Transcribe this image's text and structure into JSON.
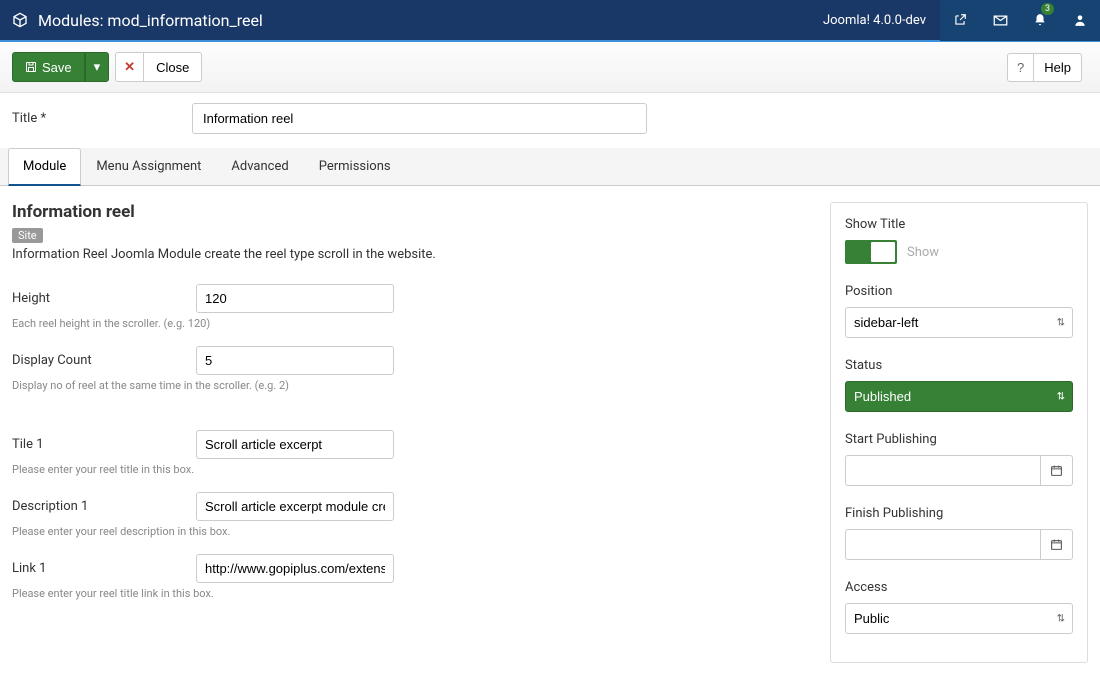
{
  "header": {
    "title": "Modules: mod_information_reel",
    "version": "Joomla! 4.0.0-dev",
    "notif_count": "3"
  },
  "toolbar": {
    "save": "Save",
    "close": "Close",
    "help": "Help"
  },
  "title_field": {
    "label": "Title *",
    "value": "Information reel"
  },
  "tabs": [
    "Module",
    "Menu Assignment",
    "Advanced",
    "Permissions"
  ],
  "module": {
    "heading": "Information reel",
    "badge": "Site",
    "desc": "Information Reel Joomla Module create the reel type scroll in the website."
  },
  "fields": [
    {
      "label": "Height",
      "value": "120",
      "hint": "Each reel height in the scroller. (e.g. 120)"
    },
    {
      "label": "Display Count",
      "value": "5",
      "hint": "Display no of reel at the same time in the scroller. (e.g. 2)"
    },
    {
      "label": "Tile 1",
      "value": "Scroll article excerpt",
      "hint": "Please enter your reel title in this box."
    },
    {
      "label": "Description 1",
      "value": "Scroll article excerpt module create",
      "hint": "Please enter your reel description in this box."
    },
    {
      "label": "Link 1",
      "value": "http://www.gopiplus.com/extensions",
      "hint": "Please enter your reel title link in this box."
    }
  ],
  "sidebar": {
    "show_title": {
      "label": "Show Title",
      "state": "Show"
    },
    "position": {
      "label": "Position",
      "value": "sidebar-left"
    },
    "status": {
      "label": "Status",
      "value": "Published"
    },
    "start_pub": {
      "label": "Start Publishing",
      "value": ""
    },
    "finish_pub": {
      "label": "Finish Publishing",
      "value": ""
    },
    "access": {
      "label": "Access",
      "value": "Public"
    }
  }
}
